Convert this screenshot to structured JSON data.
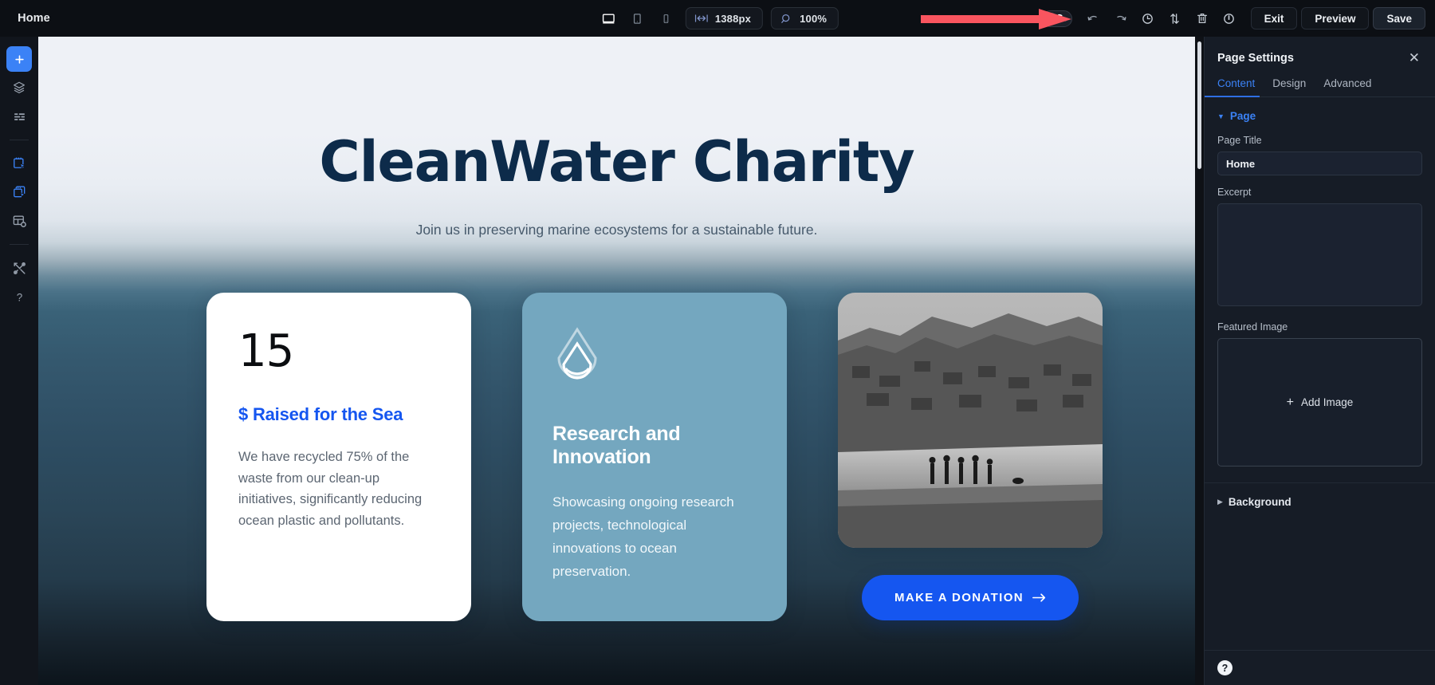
{
  "topbar": {
    "logo_icon": "gear-icon",
    "page_name": "Home",
    "devices": [
      {
        "name": "desktop",
        "icon": "desktop-icon",
        "active": true
      },
      {
        "name": "tablet",
        "icon": "tablet-icon",
        "active": false
      },
      {
        "name": "mobile",
        "icon": "mobile-icon",
        "active": false
      }
    ],
    "width_chip": {
      "icon": "width-arrows-icon",
      "label": "1388px"
    },
    "zoom_chip": {
      "icon": "magnifier-icon",
      "label": "100%"
    },
    "dark_mode_toggle": {
      "icon": "moon-icon",
      "state": "off"
    },
    "icons": [
      {
        "name": "undo-icon",
        "title": "Undo"
      },
      {
        "name": "redo-icon",
        "title": "Redo"
      },
      {
        "name": "history-clock-icon",
        "title": "History"
      },
      {
        "name": "transfer-arrows-icon",
        "title": "Transfer"
      },
      {
        "name": "trash-icon",
        "title": "Delete"
      },
      {
        "name": "power-icon",
        "title": "Power"
      }
    ],
    "exit_label": "Exit",
    "preview_label": "Preview",
    "save_label": "Save"
  },
  "annotation": {
    "arrow_color": "#f9555f",
    "points_to": "dark-mode-toggle"
  },
  "rail": {
    "items": [
      {
        "name": "add-element",
        "icon": "plus-icon",
        "active": true
      },
      {
        "name": "layers",
        "icon": "layers-icon",
        "active": false
      },
      {
        "name": "list-view",
        "icon": "list-icon",
        "active": false
      },
      {
        "name": "divider-1",
        "icon": "divider",
        "active": false
      },
      {
        "name": "select-element",
        "icon": "select-cursor-icon",
        "active": false
      },
      {
        "name": "duplicate-element",
        "icon": "copy-cursor-icon",
        "active": false
      },
      {
        "name": "global-settings",
        "icon": "grid-settings-icon",
        "active": false
      },
      {
        "name": "divider-2",
        "icon": "divider",
        "active": false
      },
      {
        "name": "tools",
        "icon": "tools-icon",
        "active": false
      },
      {
        "name": "help",
        "icon": "question-icon",
        "active": false
      }
    ]
  },
  "canvas": {
    "hero": {
      "title": "CleanWater Charity",
      "subtitle": "Join us in preserving marine ecosystems for a sustainable future."
    },
    "cards": [
      {
        "type": "stat",
        "number": "15",
        "label": "$ Raised for the Sea",
        "body": "We have recycled 75% of the waste from our clean-up initiatives, significantly reducing ocean plastic and pollutants.",
        "label_color": "#1556f0",
        "bg_color": "#ffffff"
      },
      {
        "type": "feature",
        "icon": "water-drop-icon",
        "title": "Research and Innovation",
        "body": "Showcasing ongoing research projects, technological innovations to ocean preservation.",
        "bg_color": "#74a7bf"
      },
      {
        "type": "media",
        "image_alt": "Black and white coastal photo with people on the beach",
        "cta_label": "MAKE A DONATION",
        "cta_icon": "arrow-right-icon",
        "cta_color": "#1556f0"
      }
    ]
  },
  "panel": {
    "title": "Page Settings",
    "close_icon": "close-icon",
    "tabs": [
      {
        "label": "Content",
        "active": true
      },
      {
        "label": "Design",
        "active": false
      },
      {
        "label": "Advanced",
        "active": false
      }
    ],
    "sections": [
      {
        "name": "page",
        "label": "Page",
        "expanded": true
      },
      {
        "name": "background",
        "label": "Background",
        "expanded": false
      }
    ],
    "fields": {
      "page_title_label": "Page Title",
      "page_title_value": "Home",
      "excerpt_label": "Excerpt",
      "excerpt_value": "",
      "featured_image_label": "Featured Image",
      "add_image_label": "Add Image",
      "add_image_icon": "plus-icon"
    },
    "footer": {
      "help_icon": "question-mark-circle-icon"
    }
  }
}
